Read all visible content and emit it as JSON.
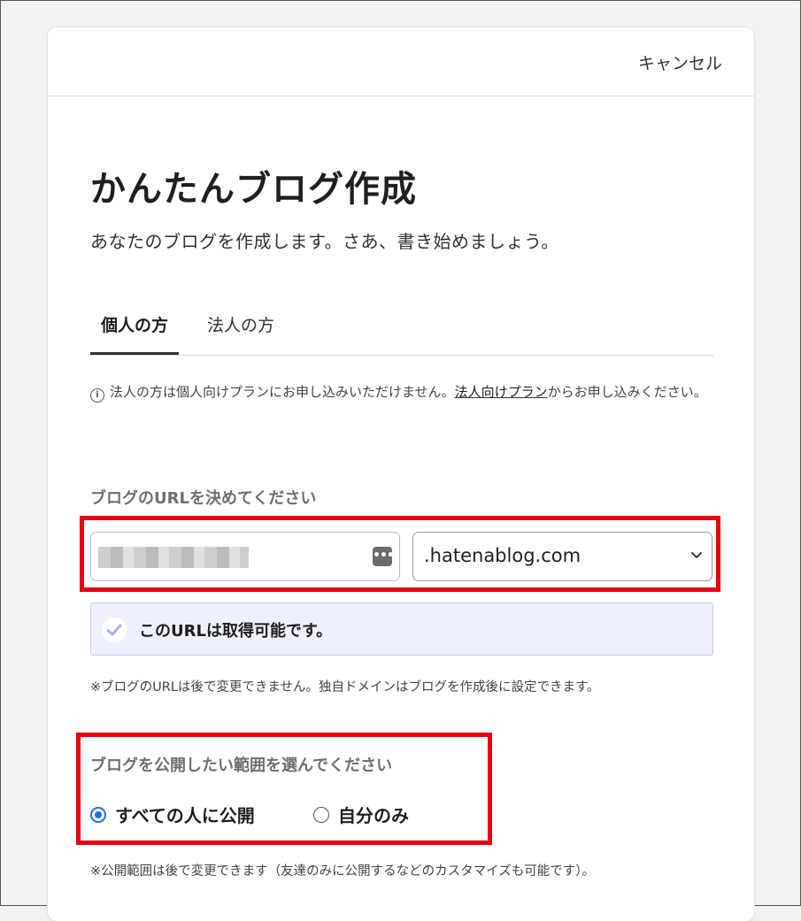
{
  "header": {
    "cancel_label": "キャンセル"
  },
  "page": {
    "title": "かんたんブログ作成",
    "subtitle": "あなたのブログを作成します。さあ、書き始めましょう。"
  },
  "tabs": [
    {
      "label": "個人の方",
      "active": true
    },
    {
      "label": "法人の方",
      "active": false
    }
  ],
  "notice": {
    "text_before": "法人の方は個人向けプランにお申し込みいただけません。",
    "link_label": "法人向けプラン",
    "text_after": "からお申し込みください。"
  },
  "url_section": {
    "label": "ブログのURLを決めてください",
    "domain_value": ".hatenablog.com",
    "status_text": "このURLは取得可能です。",
    "note": "※ブログのURLは後で変更できません。独自ドメインはブログを作成後に設定できます。"
  },
  "scope_section": {
    "label": "ブログを公開したい範囲を選んでください",
    "options": [
      {
        "label": "すべての人に公開",
        "checked": true
      },
      {
        "label": "自分のみ",
        "checked": false
      }
    ],
    "note": "※公開範囲は後で変更できます（友達のみに公開するなどのカスタマイズも可能です）。"
  },
  "colors": {
    "highlight_border": "#e60012",
    "radio_accent": "#1a73e8",
    "status_background": "#eef0fd"
  }
}
